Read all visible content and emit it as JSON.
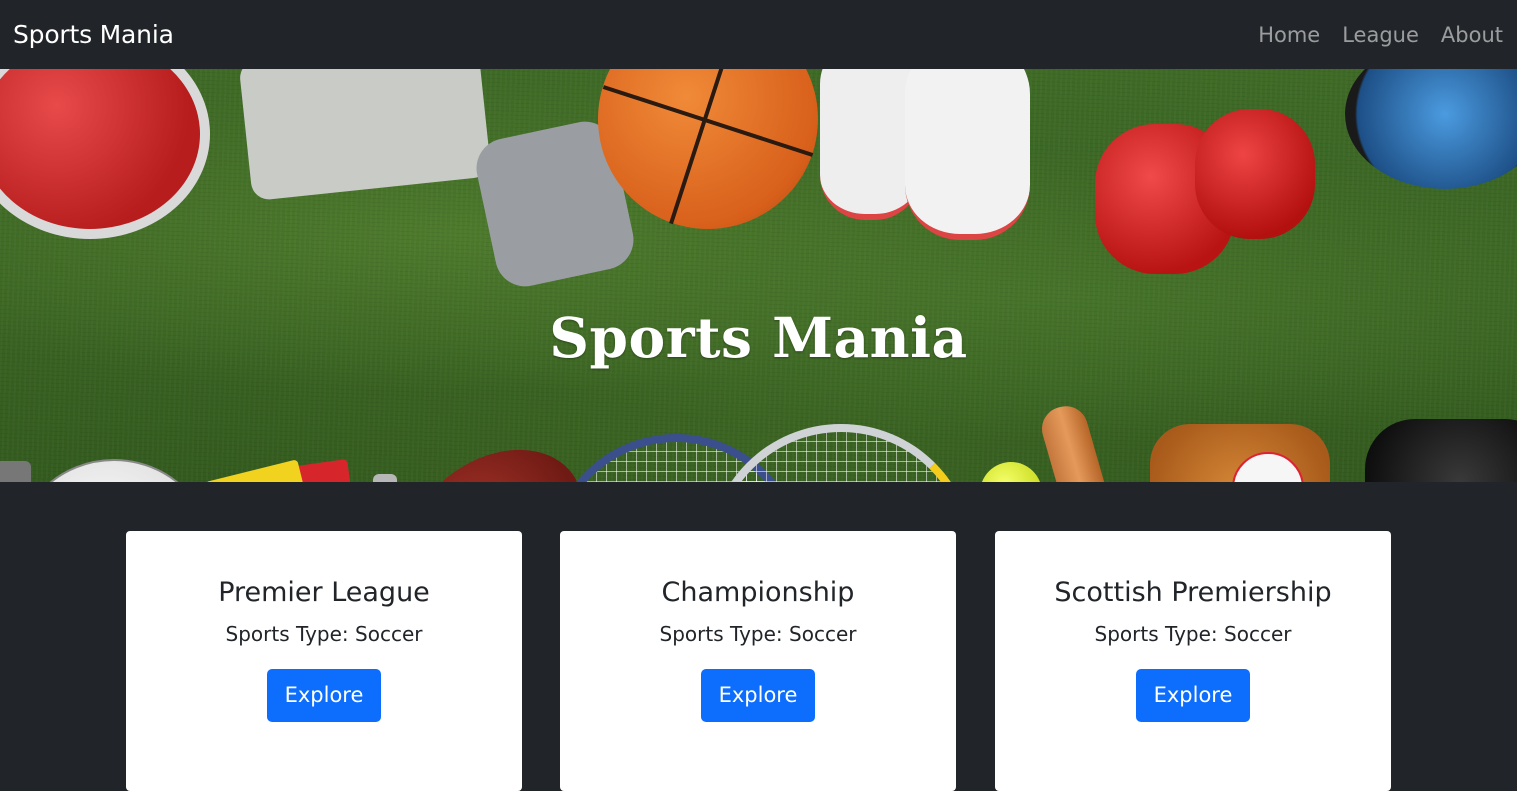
{
  "navbar": {
    "brand": "Sports Mania",
    "links": [
      "Home",
      "League",
      "About"
    ]
  },
  "hero": {
    "title": "Sports Mania",
    "background_image": "sports-equipment-on-grass"
  },
  "cards": [
    {
      "title": "Premier League",
      "type": "Sports Type: Soccer",
      "button": "Explore"
    },
    {
      "title": "Championship",
      "type": "Sports Type: Soccer",
      "button": "Explore"
    },
    {
      "title": "Scottish Premiership",
      "type": "Sports Type: Soccer",
      "button": "Explore"
    }
  ],
  "colors": {
    "navbar_bg": "#212529",
    "page_bg": "#212529",
    "button_primary": "#0d6efd",
    "card_bg": "#ffffff"
  }
}
